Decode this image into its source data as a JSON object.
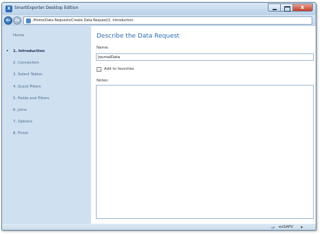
{
  "window": {
    "title": "SmartExporter Desktop Edition",
    "app_icon": "X"
  },
  "navigation": {
    "back_icon": "←",
    "forward_icon": "→",
    "address": "/Home/Data Requests/Create Data Request/1. Introduction"
  },
  "sidebar": {
    "home": "Home",
    "active_bullet": "•",
    "items": [
      {
        "label": "1. Introduction",
        "active": true
      },
      {
        "label": "2. Connection"
      },
      {
        "label": "3. Select Tables"
      },
      {
        "label": "4. Quick Filters"
      },
      {
        "label": "5. Fields and Filters"
      },
      {
        "label": "6. Joins"
      },
      {
        "label": "7. Options"
      },
      {
        "label": "8. Finish"
      }
    ]
  },
  "main": {
    "heading": "Describe the Data Request",
    "name_label": "Name:",
    "name_value": "JournalData",
    "favorites_label": "Add to favorites",
    "notes_label": "Notes:"
  },
  "statusbar": {
    "icon": "✑",
    "text": "exSAPV",
    "caret": "▾"
  },
  "colors": {
    "accent": "#2a6bb0",
    "sidebar_bg": "#cfe0f1",
    "content_bg": "#ffffff"
  }
}
